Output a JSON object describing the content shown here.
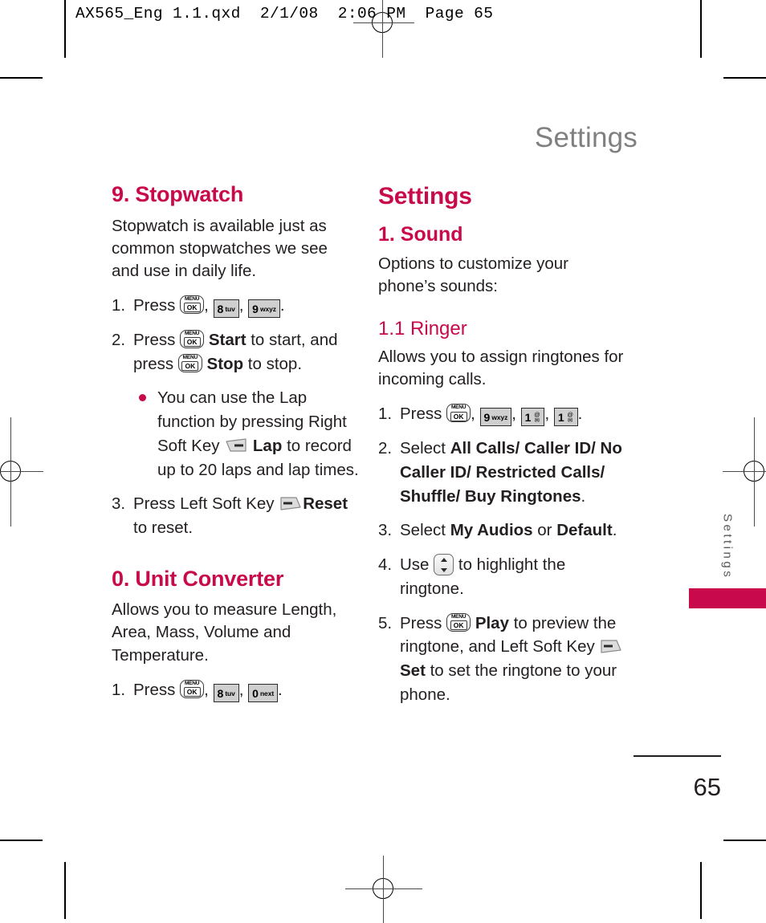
{
  "print_header": "AX565_Eng 1.1.qxd  2/1/08  2:06 PM  Page 65",
  "running_head": "Settings",
  "side_tab": {
    "label": "Settings"
  },
  "folio": {
    "page_number": "65"
  },
  "colors": {
    "accent": "#C8094B",
    "body_text": "#231f20",
    "running_head": "#808080",
    "side_tab_text": "#58595b"
  },
  "keys": {
    "menuok": {
      "top": "MENU",
      "bottom": "OK"
    },
    "num8": {
      "digit": "8",
      "letters": "tuv"
    },
    "num9": {
      "digit": "9",
      "letters": "wxyz"
    },
    "num0": {
      "digit": "0",
      "letters": "next"
    },
    "num1": {
      "digit": "1",
      "glyph_top": "@",
      "glyph_bottom": "✉"
    },
    "left_soft": "left-soft-key",
    "right_soft": "right-soft-key",
    "nav_updown": "up-down-navigation-key"
  },
  "left_column": {
    "stopwatch": {
      "heading": "9. Stopwatch",
      "intro": "Stopwatch is available just as common stopwatches we see and use in daily life.",
      "step1_num": "1.",
      "step1_a": "Press",
      "step1_comma1": ",",
      "step1_comma2": ",",
      "step1_period": ".",
      "step2_num": "2.",
      "step2_a": "Press",
      "step2_start": "Start",
      "step2_b": "to start, and press",
      "step2_stop": "Stop",
      "step2_c": "to stop.",
      "bullet_a": "You can use the Lap function by pressing Right Soft Key",
      "bullet_lap": "Lap",
      "bullet_b": "to record up to 20 laps and lap times.",
      "step3_num": "3.",
      "step3_a": "Press Left Soft Key",
      "step3_reset": "Reset",
      "step3_b": "to reset."
    },
    "unit_converter": {
      "heading": "0. Unit Converter",
      "intro": "Allows you to measure Length, Area, Mass, Volume and Temperature.",
      "step1_num": "1.",
      "step1_a": "Press",
      "step1_comma1": ",",
      "step1_comma2": ",",
      "step1_period": "."
    }
  },
  "right_column": {
    "heading": "Settings",
    "sound": {
      "heading": "1. Sound",
      "intro": "Options to customize your phone’s sounds:"
    },
    "ringer": {
      "heading": "1.1 Ringer",
      "intro": "Allows you to assign ringtones for incoming calls.",
      "step1_num": "1.",
      "step1_a": "Press",
      "step1_comma1": ",",
      "step1_comma2": ",",
      "step1_comma3": ",",
      "step1_period": ".",
      "step2_num": "2.",
      "step2_a": "Select",
      "step2_options": "All Calls/ Caller ID/ No Caller ID/ Restricted Calls/ Shuffle/ Buy Ringtones",
      "step2_period": ".",
      "step3_num": "3.",
      "step3_a": "Select",
      "step3_opt1": "My Audios",
      "step3_or": "or",
      "step3_opt2": "Default",
      "step3_period": ".",
      "step4_num": "4.",
      "step4_a": "Use",
      "step4_b": "to highlight the ringtone.",
      "step5_num": "5.",
      "step5_a": "Press",
      "step5_play": "Play",
      "step5_b": "to preview the ringtone, and Left Soft Key",
      "step5_set": "Set",
      "step5_c": "to set the ringtone to your phone."
    }
  }
}
